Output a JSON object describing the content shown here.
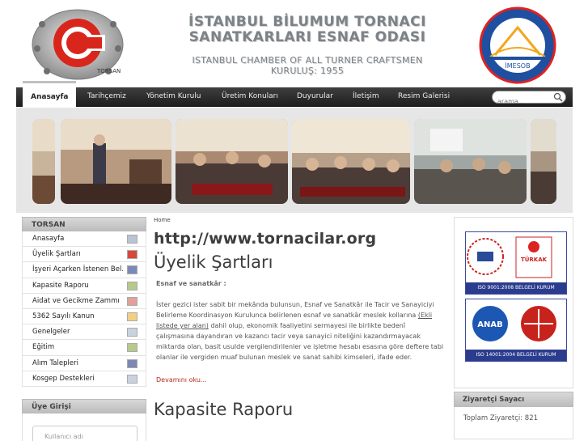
{
  "header": {
    "title_line1": "İSTANBUL BİLUMUM TORNACI",
    "title_line2": "SANATKARLARI ESNAF ODASI",
    "subtitle_line1": "ISTANBUL CHAMBER OF ALL TURNER CRAFTSMEN",
    "subtitle_line2": "KURULUŞ: 1955",
    "logo_left_text": "TORSAN",
    "logo_right_text": "İMESOB"
  },
  "nav": {
    "items": [
      {
        "label": "Anasayfa",
        "active": true
      },
      {
        "label": "Tarihçemiz"
      },
      {
        "label": "Yönetim Kurulu"
      },
      {
        "label": "Üretim Konuları"
      },
      {
        "label": "Duyurular"
      },
      {
        "label": "İletişim"
      },
      {
        "label": "Resim Galerisi"
      }
    ],
    "search_placeholder": "arama..."
  },
  "sidebar": {
    "heading": "TORSAN",
    "items": [
      {
        "label": "Anasayfa",
        "color": "#b9c3d3"
      },
      {
        "label": "Üyelik Şartları",
        "color": "#d9473a"
      },
      {
        "label": "İşyeri Açarken İstenen Bel.",
        "color": "#7c88b6"
      },
      {
        "label": "Kapasite Raporu",
        "color": "#b7c98a"
      },
      {
        "label": "Aidat ve Gecikme Zammı",
        "color": "#e2a09c"
      },
      {
        "label": "5362 Sayılı Kanun",
        "color": "#f2cf82"
      },
      {
        "label": "Genelgeler",
        "color": "#c9d3df"
      },
      {
        "label": "Eğitim",
        "color": "#b7c98a"
      },
      {
        "label": "Alım Talepleri",
        "color": "#7c88b6"
      },
      {
        "label": "Kosgep Destekleri",
        "color": "#c9d3df"
      }
    ],
    "login_heading": "Üye Girişi",
    "login_field_placeholder": "Kullanıcı adı"
  },
  "main": {
    "breadcrumb": "Home",
    "site_url": "http://www.tornacilar.org",
    "article_title": "Üyelik Şartları",
    "lead": "Esnaf ve sanatkâr :",
    "body_part1": "İster gezici ister sabit bir mekânda bulunsun, Esnaf ve Sanatkâr ile Tacir ve Sanayiciyi Belirleme Koordinasyon Kurulunca belirlenen esnaf ve sanatkâr meslek kollarına ",
    "body_link": "(Ekli listede yer alan)",
    "body_part2": " dahil olup, ekonomik faaliyetini sermayesi ile birlikte bedenî çalışmasına dayandıran ve kazancı tacir veya sanayici niteliğini kazandırmayacak miktarda olan, basit usulde vergilendirilenler ve işletme hesabı esasına göre deftere tabi olanlar ile vergiden muaf bulunan meslek ve sanat sahibi kimseleri, ifade eder.",
    "read_more": "Devamını oku...",
    "article_title2": "Kapasite Raporu"
  },
  "rightbar": {
    "cert1_label": "ISO 9001:2008 BELGELİ KURUM",
    "cert1_badge": "TÜRKAK",
    "cert2_label": "ISO 14001:2004 BELGELİ KURUM",
    "cert2_badge": "ANAB",
    "counter_heading": "Ziyaretçi Sayacı",
    "counter_label": "Toplam Ziyaretçi:",
    "counter_value": "821"
  }
}
